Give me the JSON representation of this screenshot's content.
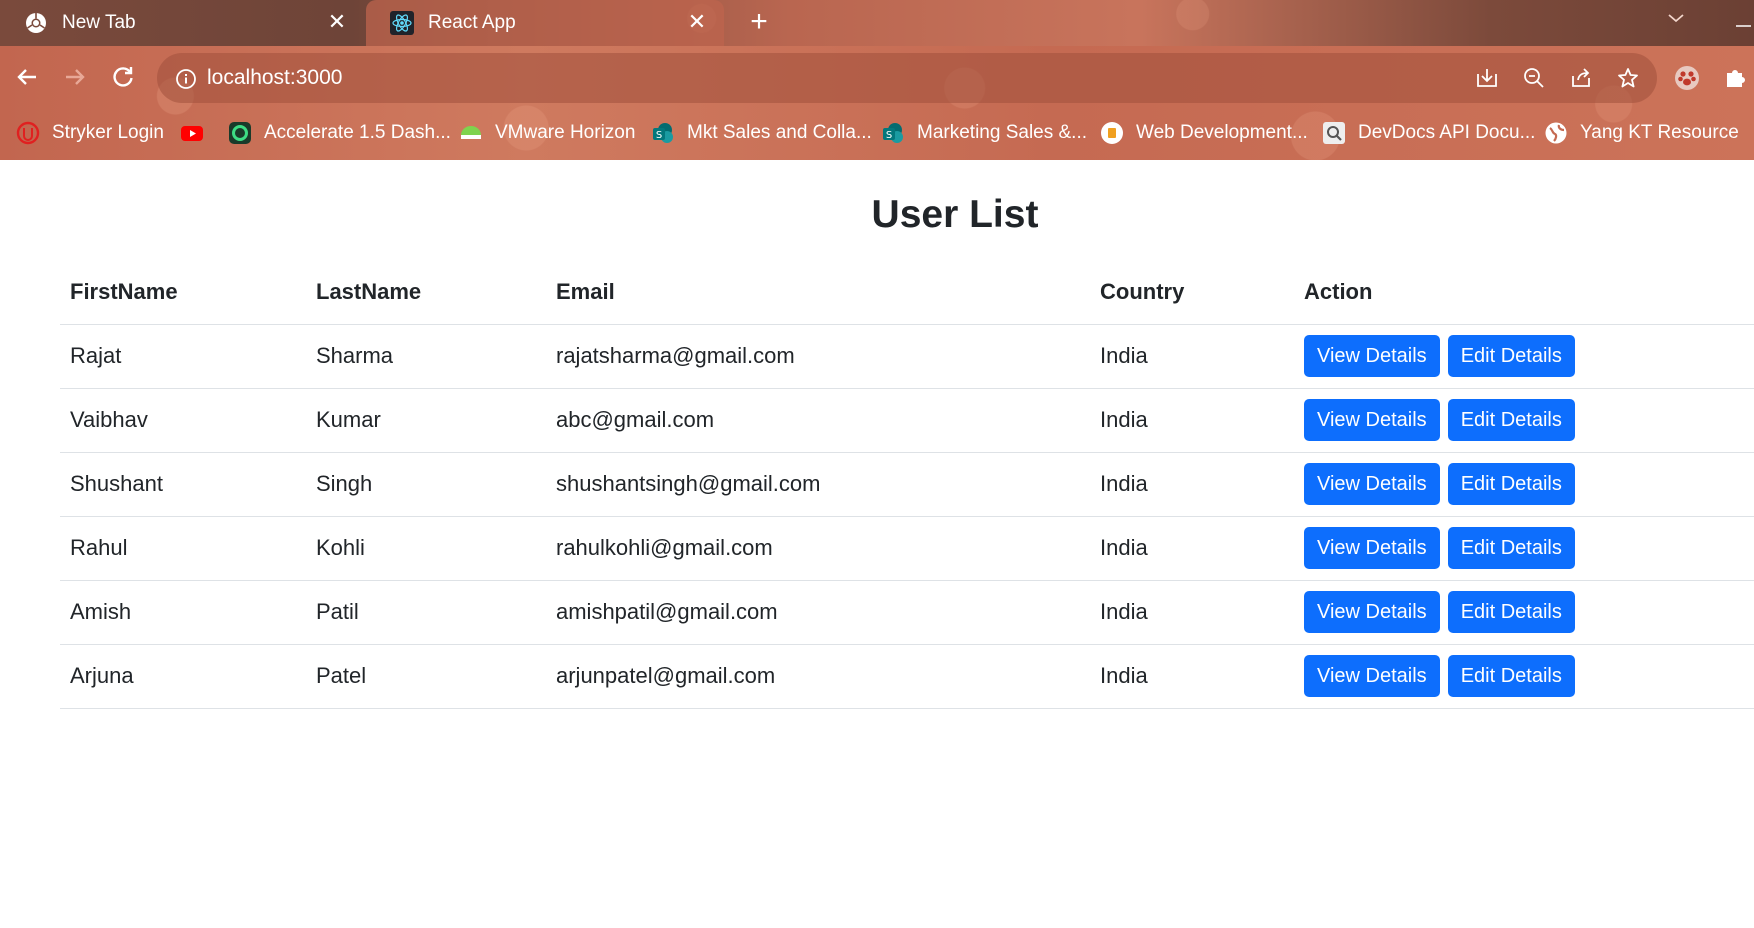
{
  "browser": {
    "tabs": [
      {
        "title": "New Tab",
        "icon": "chrome-icon"
      },
      {
        "title": "React App",
        "icon": "react-icon",
        "active": true
      }
    ],
    "url": "localhost:3000",
    "bookmarks": [
      {
        "label": "Stryker Login",
        "icon": "stryker-icon"
      },
      {
        "label": "",
        "icon": "youtube-icon"
      },
      {
        "label": "Accelerate 1.5 Dash...",
        "icon": "accelerate-icon"
      },
      {
        "label": "VMware Horizon",
        "icon": "vmware-icon"
      },
      {
        "label": "Mkt Sales and Colla...",
        "icon": "sharepoint-icon"
      },
      {
        "label": "Marketing Sales &...",
        "icon": "sharepoint-icon"
      },
      {
        "label": "Web Development...",
        "icon": "webdev-icon"
      },
      {
        "label": "DevDocs API Docu...",
        "icon": "devdocs-icon"
      },
      {
        "label": "Yang KT Resource",
        "icon": "globe-icon"
      }
    ],
    "colors": {
      "chrome": "#c56a52",
      "tabstrip": "#6e4438"
    }
  },
  "page": {
    "title": "User List",
    "table": {
      "headers": [
        "FirstName",
        "LastName",
        "Email",
        "Country",
        "Action"
      ],
      "rows": [
        {
          "first": "Rajat",
          "last": "Sharma",
          "email": "rajatsharma@gmail.com",
          "country": "India"
        },
        {
          "first": "Vaibhav",
          "last": "Kumar",
          "email": "abc@gmail.com",
          "country": "India"
        },
        {
          "first": "Shushant",
          "last": "Singh",
          "email": "shushantsingh@gmail.com",
          "country": "India"
        },
        {
          "first": "Rahul",
          "last": "Kohli",
          "email": "rahulkohli@gmail.com",
          "country": "India"
        },
        {
          "first": "Amish",
          "last": "Patil",
          "email": "amishpatil@gmail.com",
          "country": "India"
        },
        {
          "first": "Arjuna",
          "last": "Patel",
          "email": "arjunpatel@gmail.com",
          "country": "India"
        }
      ],
      "view_label": "View Details",
      "edit_label": "Edit Details"
    },
    "colors": {
      "button": "#0d6efd",
      "text": "#212529"
    }
  }
}
